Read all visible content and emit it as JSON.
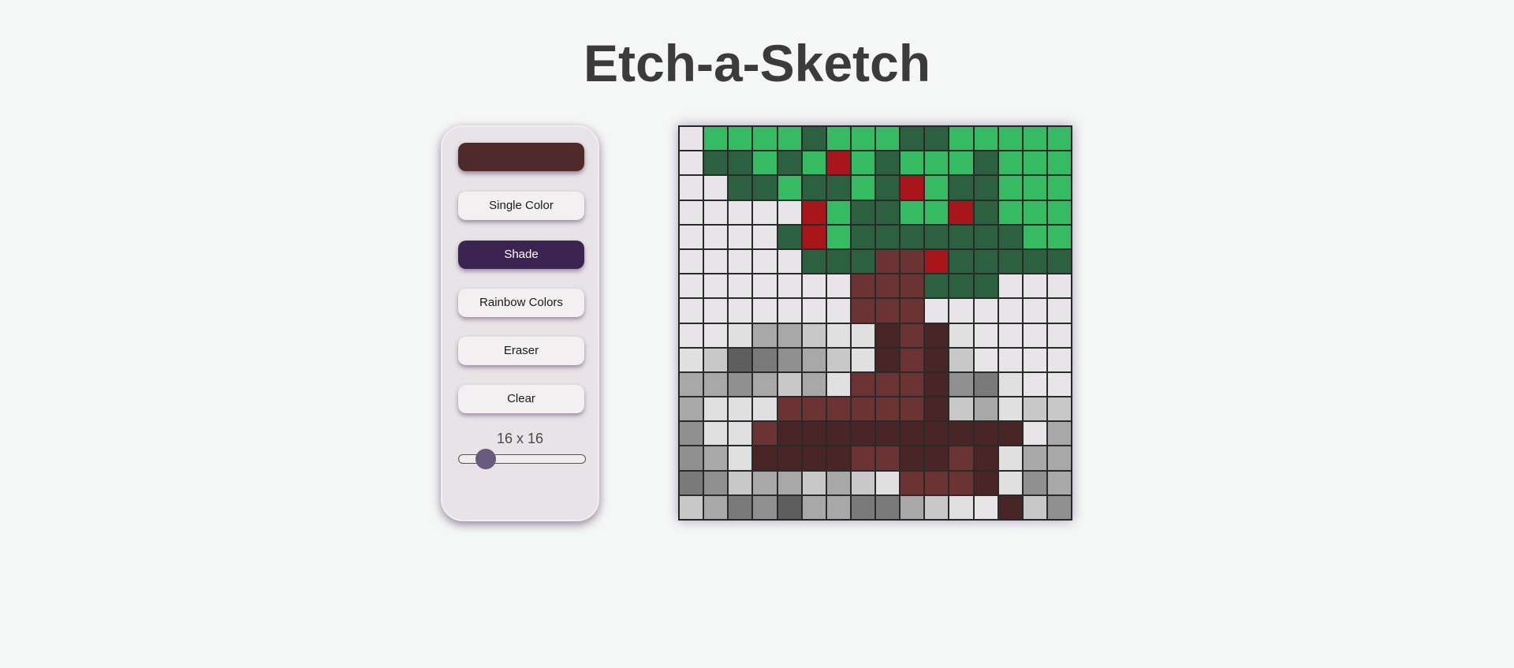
{
  "title": "Etch-a-Sketch",
  "controls": {
    "color_value": "#4f2a2b",
    "buttons": [
      {
        "label": "Single Color",
        "active": false
      },
      {
        "label": "Shade",
        "active": true
      },
      {
        "label": "Rainbow Colors",
        "active": false
      },
      {
        "label": "Eraser",
        "active": false
      },
      {
        "label": "Clear",
        "active": false
      }
    ],
    "size_label": "16 x 16",
    "slider": {
      "min": 1,
      "max": 100,
      "value": 16
    }
  },
  "grid": {
    "size": 16,
    "palette": {
      "a": "#e8e5e8",
      "b": "#e0e0e0",
      "c": "#c8c8c8",
      "d": "#a8a8a8",
      "e": "#909090",
      "f": "#7a7a7a",
      "g": "#5e5e5e",
      "G": "#36bb63",
      "D": "#2d6040",
      "R": "#a8161c",
      "M": "#6b3334",
      "N": "#5a2a2c",
      "K": "#4a2526"
    },
    "rows": [
      "aGGGGDGGGDDGGGGG",
      "aDDGDGRGDGGGDGGG",
      "aaDDGDDGDRGDDGGG",
      "aaaaaRGDDGGRDGGG",
      "aaaaDRGDDDDDDDGG",
      "aaaaaDDDMMRDDDDD",
      "aaaaaaaMMMDDDaaa",
      "aaaaaaaMMMaaaaaa",
      "aabddcbbKMKbaaaa",
      "bcgfedcbKMKcaaaa",
      "ddedcdbMMMKefbaa",
      "dbbbMMMMMMKcdbcc",
      "ebbMKKKKKKKKKKad",
      "edbKKKKMMKKMKbdd",
      "fecddcdcbMMMKbed",
      "cdfegddffdcbaKce"
    ]
  }
}
